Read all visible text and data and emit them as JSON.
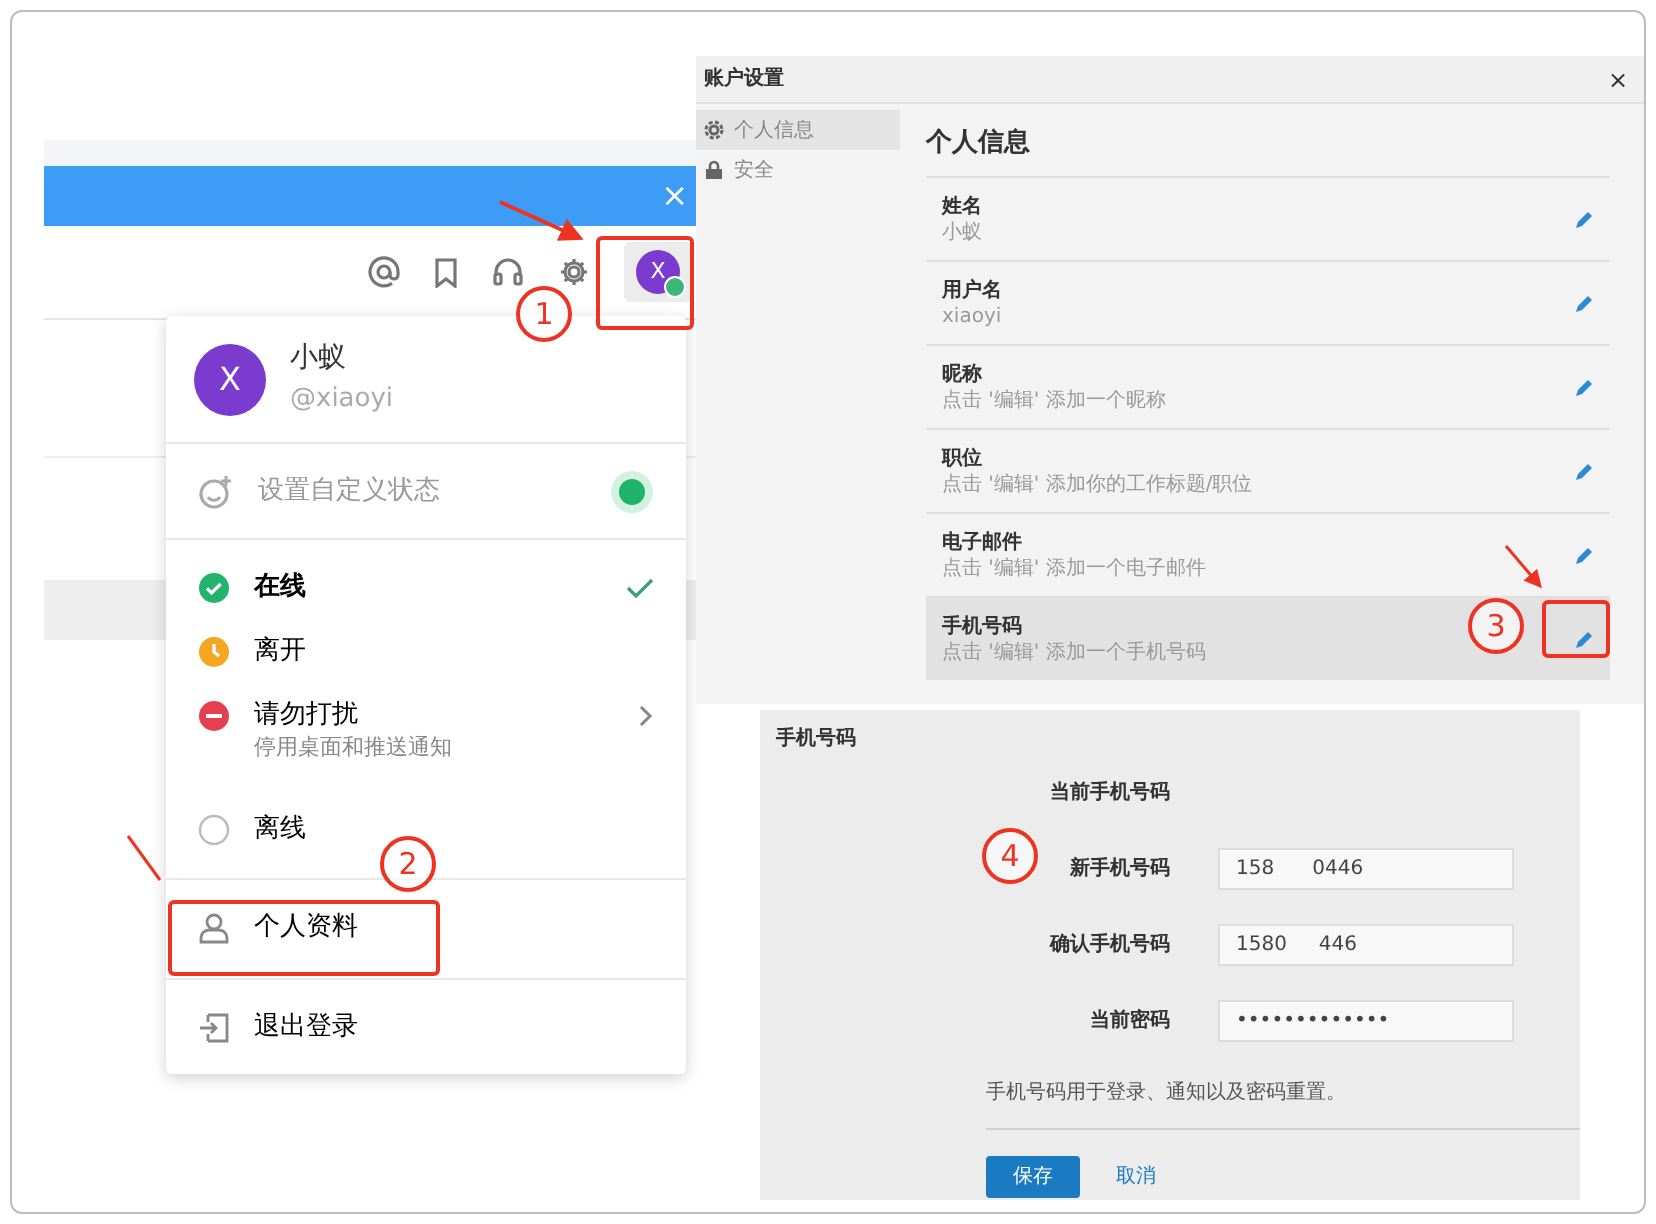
{
  "chat_app": {
    "close": "×",
    "avatar_letter": "X",
    "online": true
  },
  "profile_menu": {
    "avatar_letter": "X",
    "name": "小蚁",
    "handle": "@xiaoyi",
    "custom_status": "设置自定义状态",
    "statuses": [
      {
        "kind": "online",
        "label": "在线",
        "selected": true
      },
      {
        "kind": "away",
        "label": "离开",
        "selected": false
      },
      {
        "kind": "dnd",
        "label": "请勿打扰",
        "subtitle": "停用桌面和推送通知",
        "selected": false
      },
      {
        "kind": "offline",
        "label": "离线",
        "selected": false
      }
    ],
    "actions": [
      {
        "kind": "profile",
        "label": "个人资料"
      },
      {
        "kind": "logout",
        "label": "退出登录"
      }
    ]
  },
  "account_settings": {
    "title": "账户设置",
    "close": "×",
    "sidebar": [
      {
        "kind": "info",
        "label": "个人信息",
        "selected": true
      },
      {
        "kind": "security",
        "label": "安全",
        "selected": false
      }
    ],
    "heading": "个人信息",
    "fields": [
      {
        "label": "姓名",
        "value": "小蚁",
        "selected": false
      },
      {
        "label": "用户名",
        "value": "xiaoyi",
        "selected": false
      },
      {
        "label": "昵称",
        "value": "点击 '编辑' 添加一个昵称",
        "selected": false
      },
      {
        "label": "职位",
        "value": "点击 '编辑' 添加你的工作标题/职位",
        "selected": false
      },
      {
        "label": "电子邮件",
        "value": "点击 '编辑' 添加一个电子邮件",
        "selected": false
      },
      {
        "label": "手机号码",
        "value": "点击 '编辑' 添加一个手机号码",
        "selected": true
      }
    ]
  },
  "phone_dialog": {
    "title": "手机号码",
    "rows": [
      {
        "label": "当前手机号码"
      },
      {
        "label": "新手机号码",
        "value": "158      0446"
      },
      {
        "label": "确认手机号码",
        "value": "1580     446"
      },
      {
        "label": "当前密码",
        "value": "•••••••••••••"
      }
    ],
    "help": "手机号码用于登录、通知以及密码重置。",
    "save": "保存",
    "cancel": "取消"
  },
  "annotations": [
    "1",
    "2",
    "3",
    "4"
  ]
}
